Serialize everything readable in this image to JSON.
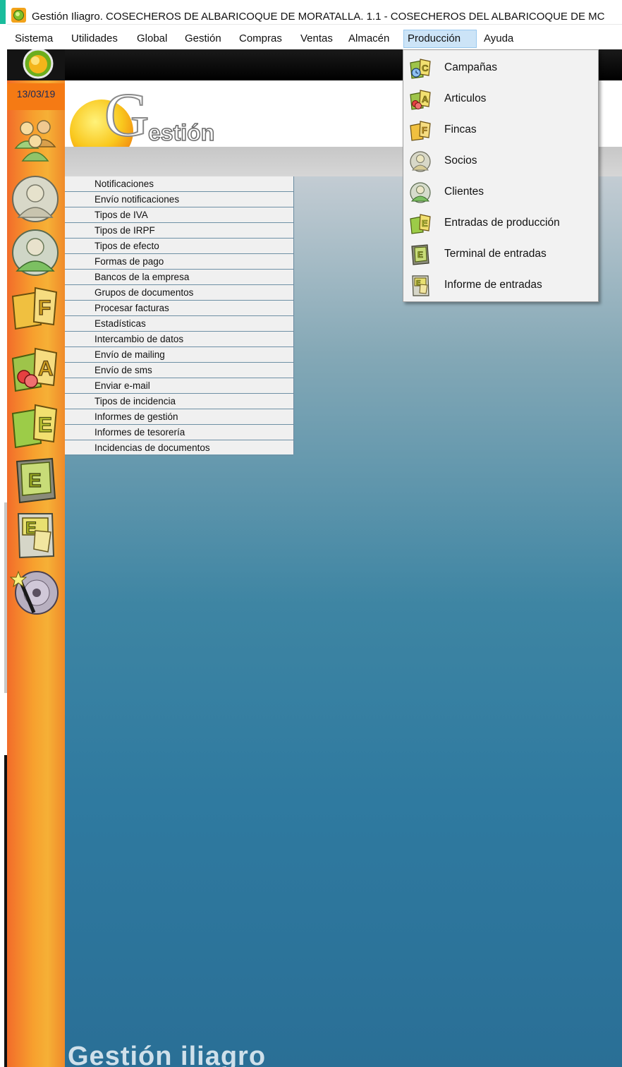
{
  "window": {
    "title": "Gestión Iliagro. COSECHEROS DE ALBARICOQUE DE MORATALLA. 1.1 - COSECHEROS DEL ALBARICOQUE DE MC"
  },
  "menubar": {
    "items": [
      {
        "label": "Sistema"
      },
      {
        "label": "Utilidades"
      },
      {
        "label": "Global"
      },
      {
        "label": "Gestión"
      },
      {
        "label": "Compras"
      },
      {
        "label": "Ventas"
      },
      {
        "label": "Almacén"
      },
      {
        "label": "Producción",
        "active": true
      },
      {
        "label": "Ayuda"
      }
    ]
  },
  "sidebar": {
    "date": "13/03/19",
    "buttons": [
      "socios-group-icon",
      "socio-icon",
      "cliente-icon",
      "fincas-icon",
      "articulos-icon",
      "entradas-produccion-icon",
      "terminal-entradas-icon",
      "informe-entradas-icon",
      "disc-wand-icon"
    ]
  },
  "header": {
    "logo_letter": "G",
    "logo_text": "estión"
  },
  "list": {
    "items": [
      "Notificaciones",
      "Envío notificaciones",
      "Tipos de IVA",
      "Tipos de IRPF",
      "Tipos de efecto",
      "Formas de pago",
      "Bancos de la empresa",
      "Grupos de documentos",
      "Procesar facturas",
      "Estadísticas",
      "Intercambio de datos",
      "Envío de mailing",
      "Envío de sms",
      "Enviar e-mail",
      "Tipos de incidencia",
      "Informes de gestión",
      "Informes de tesorería",
      "Incidencias de documentos"
    ]
  },
  "dropdown": {
    "items": [
      {
        "label": "Campañas",
        "icon": "campanas-icon"
      },
      {
        "label": "Articulos",
        "icon": "articulos-icon"
      },
      {
        "label": "Fincas",
        "icon": "fincas-icon"
      },
      {
        "label": "Socios",
        "icon": "socios-icon"
      },
      {
        "label": "Clientes",
        "icon": "clientes-icon"
      },
      {
        "label": "Entradas de producción",
        "icon": "entradas-produccion-icon"
      },
      {
        "label": "Terminal de entradas",
        "icon": "terminal-entradas-icon"
      },
      {
        "label": "Informe de entradas",
        "icon": "informe-entradas-icon"
      }
    ]
  },
  "footer": {
    "brand": "Gestión iliagro"
  },
  "colors": {
    "menu_active_bg": "#cce4f7",
    "sidebar_orange": "#f7a02e",
    "main_blue": "#2f7aa0"
  }
}
